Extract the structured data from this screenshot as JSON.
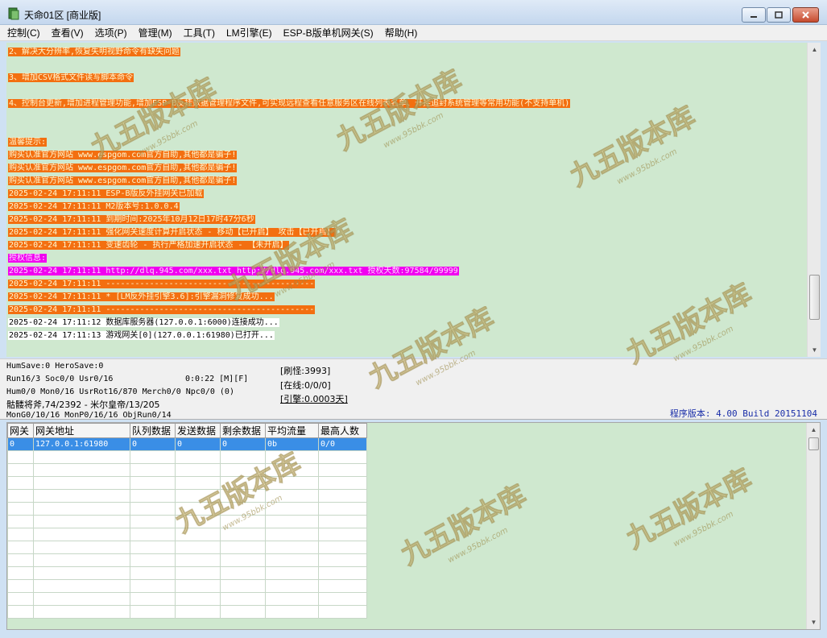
{
  "window": {
    "title": "天命01区 [商业版]"
  },
  "menu": [
    {
      "label": "控制(C)"
    },
    {
      "label": "查看(V)"
    },
    {
      "label": "选项(P)"
    },
    {
      "label": "管理(M)"
    },
    {
      "label": "工具(T)"
    },
    {
      "label": "LM引擎(E)"
    },
    {
      "label": "ESP-B版单机网关(S)"
    },
    {
      "label": "帮助(H)"
    }
  ],
  "log": [
    {
      "text": "2、解决大分辨率,恢复失明视野命令有缺失问题",
      "style": "orange"
    },
    {
      "text": "",
      "style": "none"
    },
    {
      "text": "3、增加CSV格式文件读写脚本命令",
      "style": "orange"
    },
    {
      "text": "",
      "style": "none"
    },
    {
      "text": "4、控制台更新,增加进程管理功能,增加ESP-B反挂数据管理程序文件,可实现远程查看任意服务区在线列表名单、开挂追封系统管理等常用功能(不支持单机)",
      "style": "orange"
    },
    {
      "text": "",
      "style": "none"
    },
    {
      "text": "",
      "style": "none"
    },
    {
      "text": "温馨提示:",
      "style": "orange"
    },
    {
      "text": "购买认准官方网站 www.espgom.com官方自助,其他都是骗子!",
      "style": "orange"
    },
    {
      "text": "购买认准官方网站 www.espgom.com官方自助,其他都是骗子!",
      "style": "orange"
    },
    {
      "text": "购买认准官方网站 www.espgom.com官方自助,其他都是骗子!",
      "style": "orange"
    },
    {
      "text": "2025-02-24 17:11:11 ESP-B版反外挂网关已加载",
      "style": "orange"
    },
    {
      "text": "2025-02-24 17:11:11 M2版本号:1.0.0.4",
      "style": "orange"
    },
    {
      "text": "2025-02-24 17:11:11 到期时间:2025年10月12日17时47分6秒",
      "style": "orange"
    },
    {
      "text": "2025-02-24 17:11:11 强化网关速度计算开启状态 - 移动【已开启】 攻击【已开启】",
      "style": "orange"
    },
    {
      "text": "2025-02-24 17:11:11 变速齿轮 - 执行严格加速开启状态 - 【未开启】",
      "style": "orange"
    },
    {
      "text": "授权信息:",
      "style": "magenta"
    },
    {
      "text": "2025-02-24 17:11:11 http://dlq.945.com/xxx.txt http://dlq.945.com/xxx.txt 授权天数:97584/99999",
      "style": "magenta"
    },
    {
      "text": "2025-02-24 17:11:11 -------------------------------------------",
      "style": "orange"
    },
    {
      "text": "2025-02-24 17:11:11 * [LM反外挂引擎3.6]:引擎漏洞修复成功...",
      "style": "orange"
    },
    {
      "text": "2025-02-24 17:11:11 -------------------------------------------",
      "style": "orange"
    },
    {
      "text": "2025-02-24 17:11:12 数据库服务器(127.0.0.1:6000)连接成功...",
      "style": "white"
    },
    {
      "text": "2025-02-24 17:11:13 游戏网关[0](127.0.0.1:61980)已打开...",
      "style": "white"
    }
  ],
  "status": {
    "hum_save": "HumSave:0 HeroSave:0",
    "run": "Run16/3 Soc0/0 Usr0/16",
    "timer": "0:0:22 [M][F]",
    "hum": "Hum0/0 Mon0/16 UsrRot16/870 Merch0/0 Npc0/0 (0)",
    "boss": "骷髅将斧,74/2392 - 米尔皇帝/13/205",
    "mon": "MonG0/10/16 MonP0/16/16 ObjRun0/14",
    "refresh": "[刷怪:3993]",
    "online": "[在线:0/0/0]",
    "engine": "[引擎:0.0003天]",
    "version": "程序版本: 4.00 Build 20151104"
  },
  "gateway_table": {
    "columns": [
      "网关",
      "网关地址",
      "队列数据",
      "发送数据",
      "剩余数据",
      "平均流量",
      "最高人数"
    ],
    "rows": [
      [
        "0",
        "127.0.0.1:61980",
        "0",
        "0",
        "0",
        "0b",
        "0/0"
      ]
    ]
  },
  "watermark": {
    "text": "九五版本库",
    "url": "www.95bbk.com"
  },
  "colors": {
    "log_bg": "#cfe8cf",
    "highlight_orange": "#f36f10",
    "highlight_magenta": "#f000f0",
    "selected_row": "#3a8ee6",
    "version_text": "#1a2ea8"
  },
  "icons": [
    "app-icon",
    "minimize-icon",
    "maximize-icon",
    "close-icon",
    "scroll-up-icon",
    "scroll-down-icon"
  ]
}
